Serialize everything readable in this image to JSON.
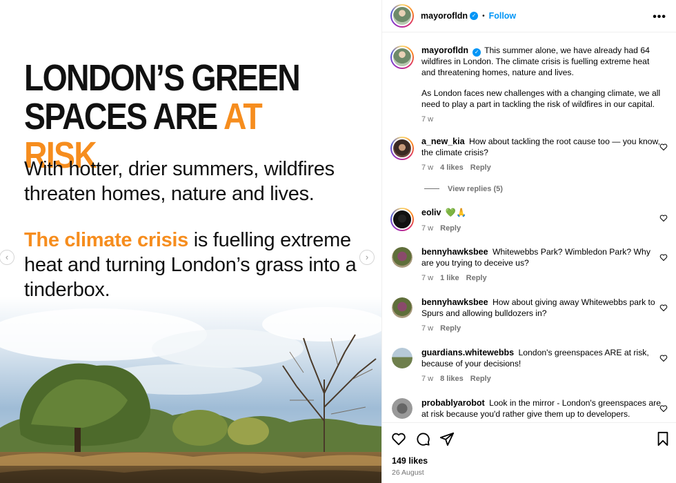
{
  "media": {
    "headline_line1": "LONDON’S GREEN",
    "headline_line2_a": "SPACES ARE ",
    "headline_line2_b": "AT RISK",
    "para1": "With hotter, drier summers, wildfires threaten homes, nature and lives.",
    "para2_highlight": "The climate crisis",
    "para2_rest": " is fuelling extreme heat and turning London’s grass into a tinderbox.",
    "accent_color": "#f68d1e",
    "arrow_left": "‹",
    "arrow_right": "›"
  },
  "header": {
    "username": "mayorofldn",
    "separator": "•",
    "follow_label": "Follow",
    "more_label": "•••"
  },
  "caption": {
    "username": "mayorofldn",
    "text1": "This summer alone, we have already had 64 wildfires in London. The climate crisis is fuelling extreme heat and threatening homes, nature and lives.",
    "text2": "As London faces new challenges with a changing climate, we all need to play a part in tackling the risk of wildfires in our capital.",
    "time": "7 w"
  },
  "comments": [
    {
      "username": "a_new_kia",
      "text": "How about tackling the root cause too — you know, the climate crisis?",
      "time": "7 w",
      "likes": "4 likes",
      "reply": "Reply"
    },
    {
      "username": "eoliv",
      "text": "💚🙏",
      "time": "7 w",
      "reply": "Reply"
    },
    {
      "username": "bennyhawksbee",
      "text": "Whitewebbs Park? Wimbledon Park? Why are you trying to deceive us?",
      "time": "7 w",
      "likes": "1 like",
      "reply": "Reply"
    },
    {
      "username": "bennyhawksbee",
      "text": "How about giving away Whitewebbs park to Spurs and allowing bulldozers in?",
      "time": "7 w",
      "reply": "Reply"
    },
    {
      "username": "guardians.whitewebbs",
      "text": "London's greenspaces ARE at risk, because of your decisions!",
      "time": "7 w",
      "likes": "8 likes",
      "reply": "Reply"
    },
    {
      "username": "probablyarobot",
      "text": "Look in the mirror - London's greenspaces are at risk because you'd rather give them up to developers."
    }
  ],
  "view_replies": "View replies (5)",
  "footer": {
    "likes": "149 likes",
    "date": "26 August"
  },
  "icons": [
    "heart-icon",
    "comment-icon",
    "share-icon",
    "bookmark-icon",
    "verified-icon",
    "more-icon"
  ]
}
